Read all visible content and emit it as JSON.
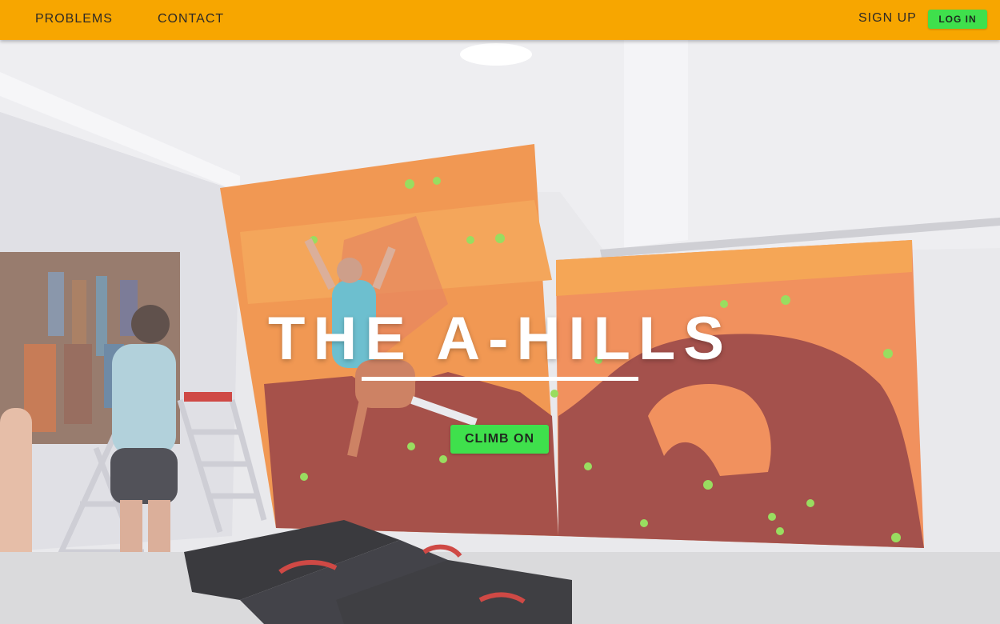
{
  "nav": {
    "problems_label": "PROBLEMS",
    "contact_label": "CONTACT",
    "signup_label": "SIGN UP",
    "login_label": "LOG IN"
  },
  "hero": {
    "title": "THE A-HILLS",
    "cta_label": "CLIMB ON",
    "background_description_icon": "climbing-gym-photo"
  },
  "colors": {
    "navbar": "#f7a600",
    "button_green": "#3fe04c",
    "title": "#ffffff"
  }
}
